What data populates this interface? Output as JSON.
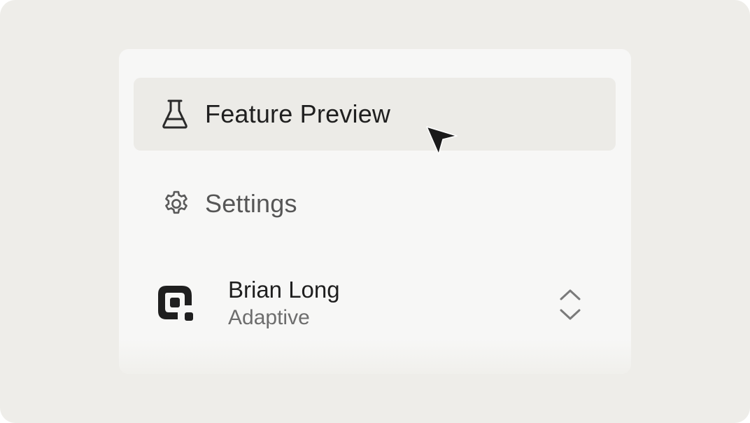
{
  "menu": {
    "items": [
      {
        "label": "Feature Preview",
        "icon": "flask-icon",
        "active": true
      },
      {
        "label": "Settings",
        "icon": "gear-icon",
        "active": false
      }
    ]
  },
  "account": {
    "name": "Brian Long",
    "plan": "Adaptive",
    "logo_icon": "workspace-logo-icon",
    "switcher_icon": "chevron-up-down-icon"
  },
  "colors": {
    "background": "#eeede9",
    "panel": "#f7f7f6",
    "active_item": "#ecebe7",
    "text_primary": "#1f1f1f",
    "text_muted": "#565656"
  }
}
